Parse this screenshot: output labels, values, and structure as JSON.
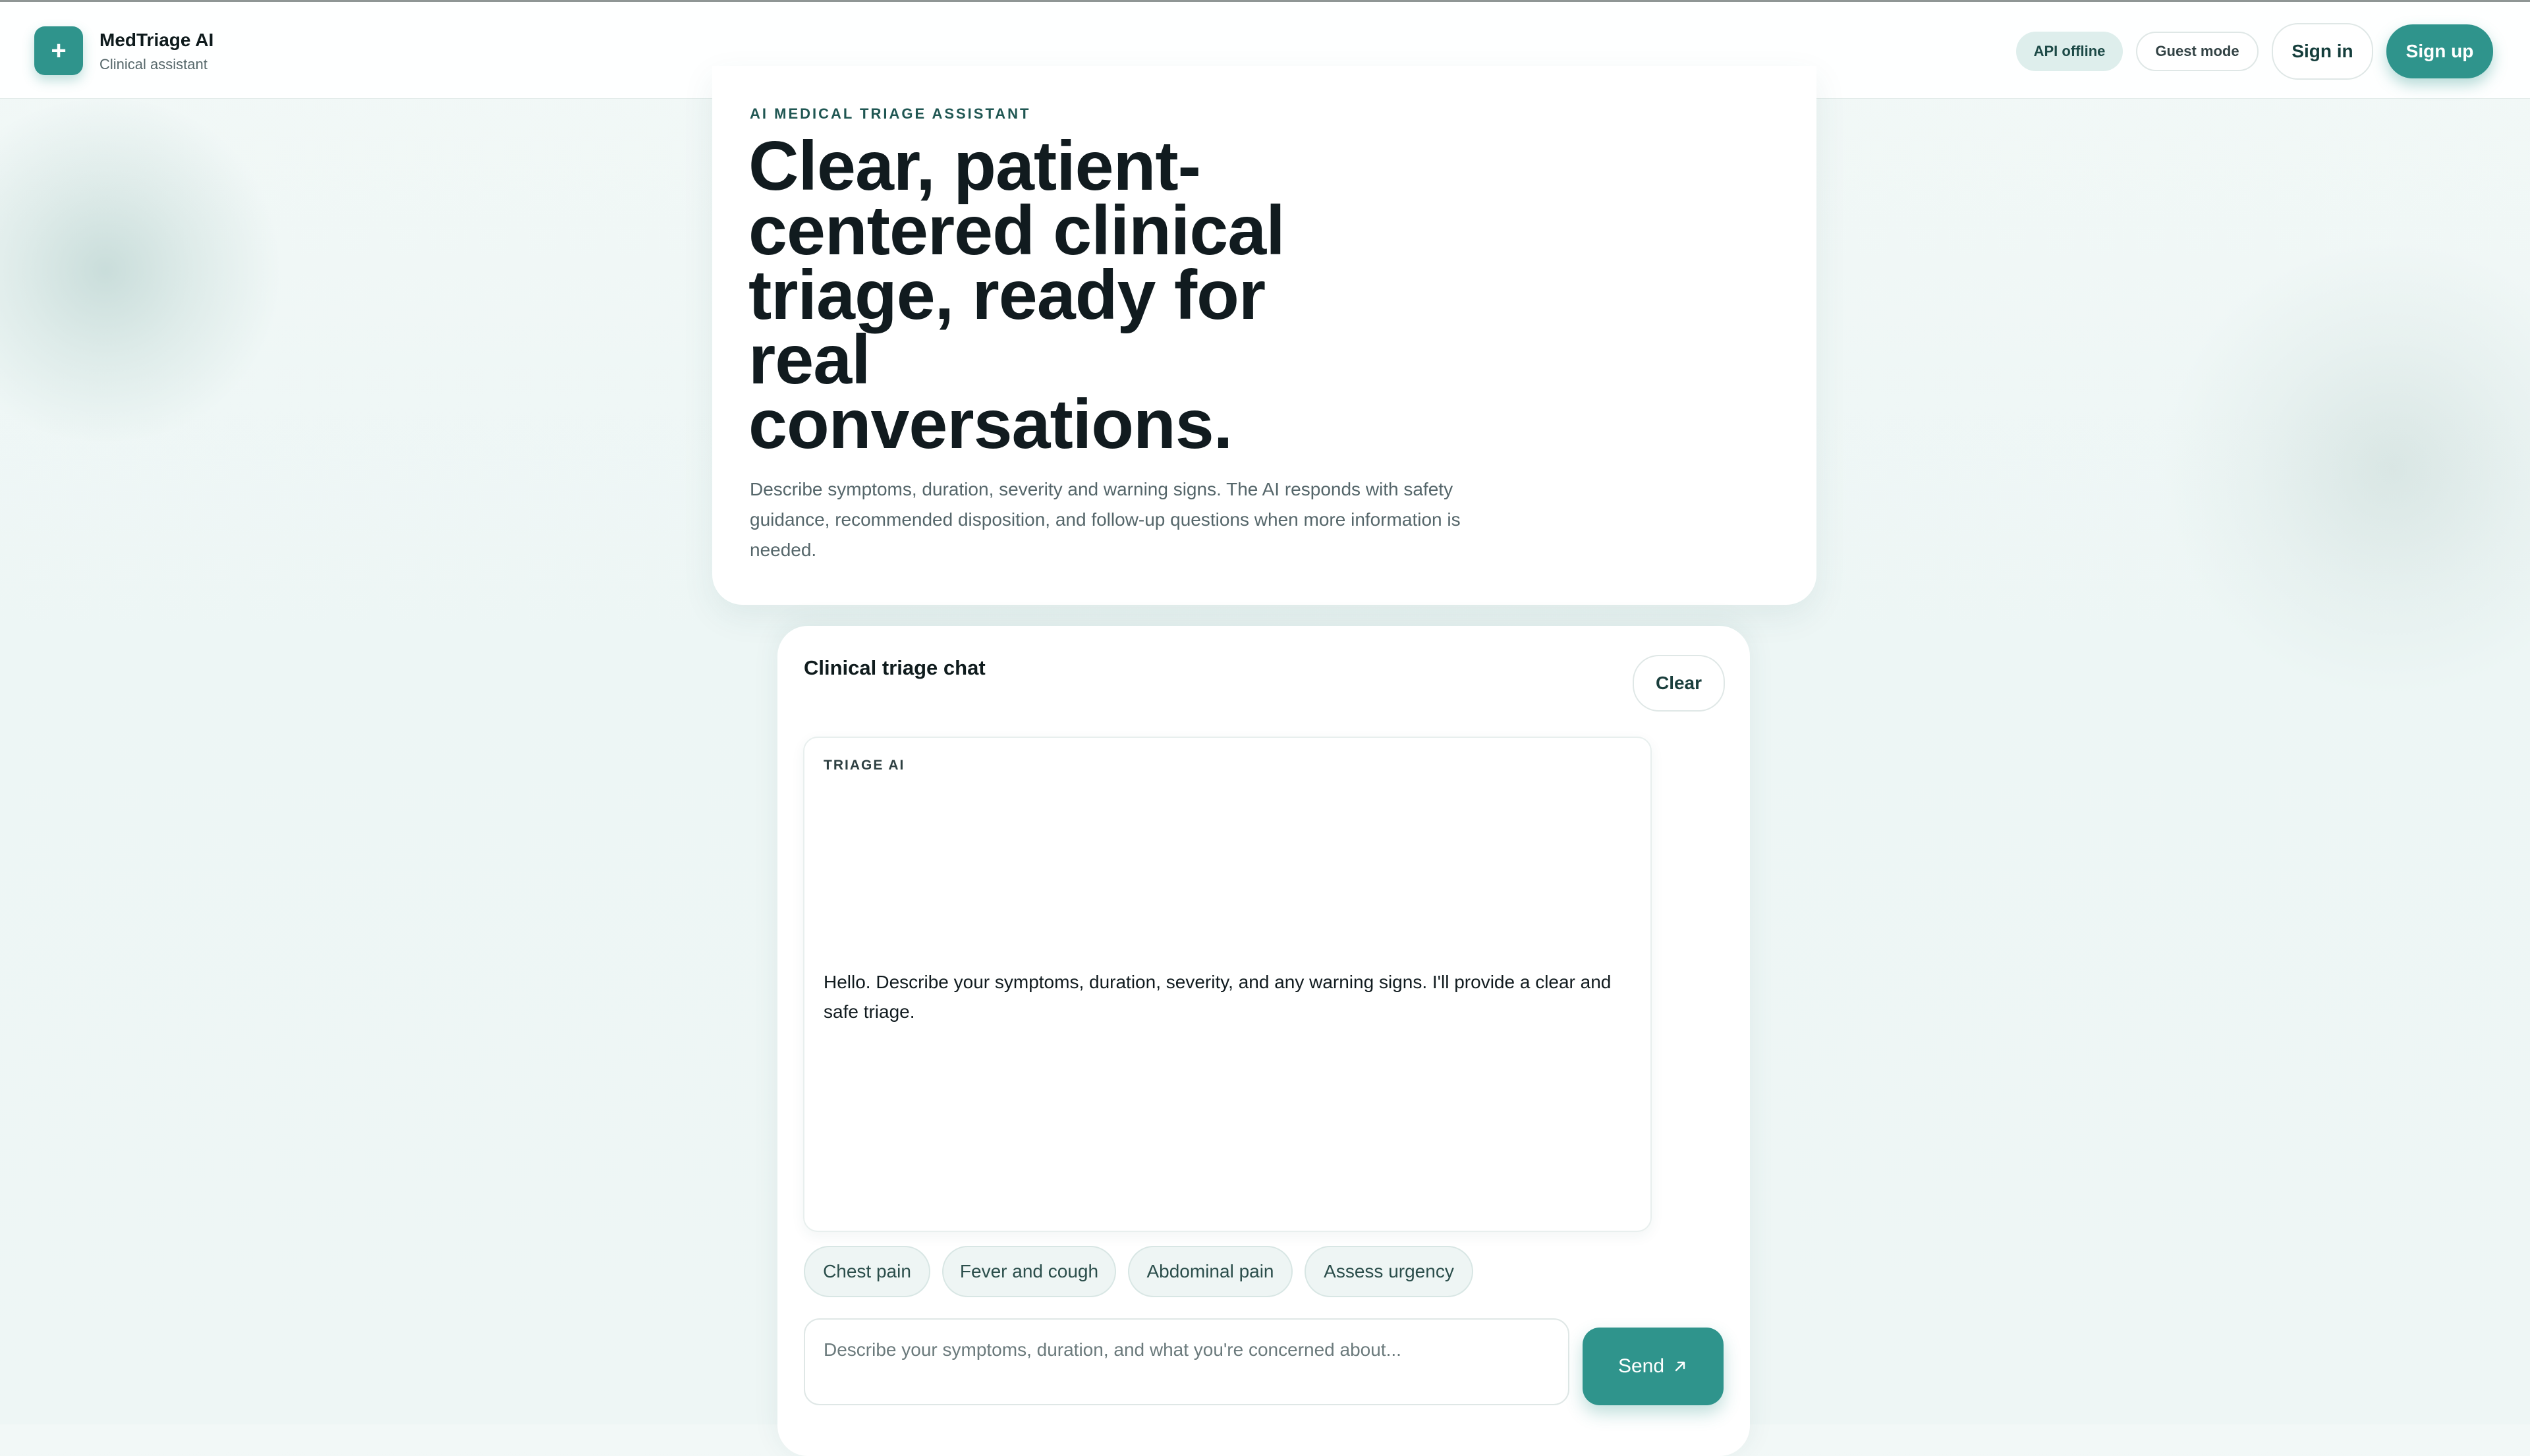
{
  "colors": {
    "accent": "#2f948c",
    "background": "#eef6f5",
    "text_dark": "#111b1f",
    "text_muted": "#55666a",
    "api_badge_bg": "#deeeec"
  },
  "header": {
    "logo_glyph": "+",
    "logo_icon": "plus-icon",
    "app_name": "MedTriage AI",
    "app_subtitle": "Clinical assistant",
    "api_status": "API offline",
    "mode_badge": "Guest mode",
    "sign_in": "Sign in",
    "sign_up": "Sign up"
  },
  "hero": {
    "eyebrow": "AI MEDICAL TRIAGE ASSISTANT",
    "title": "Clear, patient-centered clinical triage, ready for real conversations.",
    "description": "Describe symptoms, duration, severity and warning signs. The AI responds with safety guidance, recommended disposition, and follow-up questions when more information is needed."
  },
  "chat": {
    "title": "Clinical triage chat",
    "clear_label": "Clear",
    "messages": [
      {
        "author": "TRIAGE AI",
        "text": "Hello. Describe your symptoms, duration, severity, and any warning signs. I'll provide a clear and safe triage."
      }
    ],
    "quick_prompts": [
      "Chest pain",
      "Fever and cough",
      "Abdominal pain",
      "Assess urgency"
    ],
    "input": {
      "value": "",
      "placeholder": "Describe your symptoms, duration, and what you're concerned about..."
    },
    "send_label": "Send",
    "send_icon": "arrow-up-right-icon"
  }
}
